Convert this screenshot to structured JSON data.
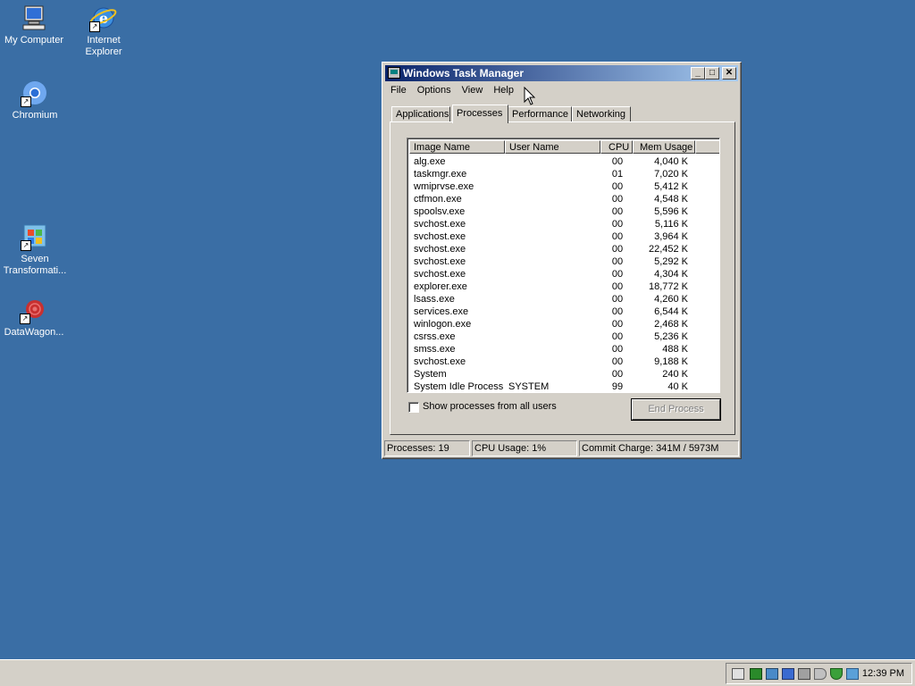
{
  "desktop": {
    "icons": [
      {
        "label": "My Computer"
      },
      {
        "label": "Internet Explorer"
      },
      {
        "label": "Chromium"
      },
      {
        "label": "Seven Transformati..."
      },
      {
        "label": "DataWagon..."
      }
    ]
  },
  "window": {
    "title": "Windows Task Manager",
    "menu": [
      "File",
      "Options",
      "View",
      "Help"
    ],
    "tabs": [
      "Applications",
      "Processes",
      "Performance",
      "Networking"
    ],
    "active_tab": "Processes",
    "columns": [
      "Image Name",
      "User Name",
      "CPU",
      "Mem Usage"
    ],
    "processes": [
      {
        "name": "alg.exe",
        "user": "",
        "cpu": "00",
        "mem": "4,040 K"
      },
      {
        "name": "taskmgr.exe",
        "user": "",
        "cpu": "01",
        "mem": "7,020 K"
      },
      {
        "name": "wmiprvse.exe",
        "user": "",
        "cpu": "00",
        "mem": "5,412 K"
      },
      {
        "name": "ctfmon.exe",
        "user": "",
        "cpu": "00",
        "mem": "4,548 K"
      },
      {
        "name": "spoolsv.exe",
        "user": "",
        "cpu": "00",
        "mem": "5,596 K"
      },
      {
        "name": "svchost.exe",
        "user": "",
        "cpu": "00",
        "mem": "5,116 K"
      },
      {
        "name": "svchost.exe",
        "user": "",
        "cpu": "00",
        "mem": "3,964 K"
      },
      {
        "name": "svchost.exe",
        "user": "",
        "cpu": "00",
        "mem": "22,452 K"
      },
      {
        "name": "svchost.exe",
        "user": "",
        "cpu": "00",
        "mem": "5,292 K"
      },
      {
        "name": "svchost.exe",
        "user": "",
        "cpu": "00",
        "mem": "4,304 K"
      },
      {
        "name": "explorer.exe",
        "user": "",
        "cpu": "00",
        "mem": "18,772 K"
      },
      {
        "name": "lsass.exe",
        "user": "",
        "cpu": "00",
        "mem": "4,260 K"
      },
      {
        "name": "services.exe",
        "user": "",
        "cpu": "00",
        "mem": "6,544 K"
      },
      {
        "name": "winlogon.exe",
        "user": "",
        "cpu": "00",
        "mem": "2,468 K"
      },
      {
        "name": "csrss.exe",
        "user": "",
        "cpu": "00",
        "mem": "5,236 K"
      },
      {
        "name": "smss.exe",
        "user": "",
        "cpu": "00",
        "mem": "488 K"
      },
      {
        "name": "svchost.exe",
        "user": "",
        "cpu": "00",
        "mem": "9,188 K"
      },
      {
        "name": "System",
        "user": "",
        "cpu": "00",
        "mem": "240 K"
      },
      {
        "name": "System Idle Process",
        "user": "SYSTEM",
        "cpu": "99",
        "mem": "40 K"
      }
    ],
    "show_all_label": "Show processes from all users",
    "show_all_checked": false,
    "end_process_label": "End Process",
    "status": {
      "processes": "Processes: 19",
      "cpu": "CPU Usage: 1%",
      "commit": "Commit Charge: 341M / 5973M"
    }
  },
  "taskbar": {
    "clock": "12:39 PM"
  },
  "colors": {
    "desktop": "#3a6ea5",
    "title_start": "#0a246a",
    "title_end": "#a6caf0",
    "face": "#d4d0c8"
  }
}
